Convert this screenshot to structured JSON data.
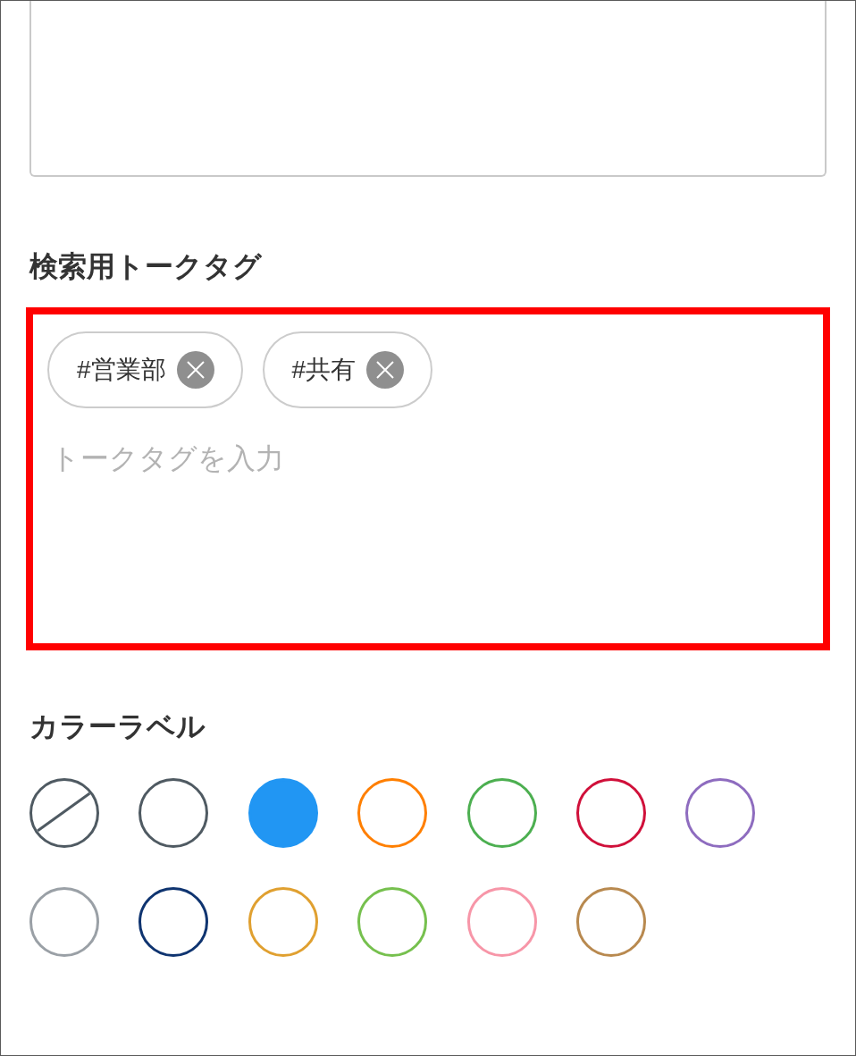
{
  "tag_section": {
    "heading": "検索用トークタグ",
    "field": {
      "highlighted": true,
      "tags": [
        "#営業部",
        "#共有"
      ],
      "placeholder": "トークタグを入力"
    }
  },
  "color_section": {
    "heading": "カラーラベル",
    "swatches": [
      {
        "kind": "none",
        "color": "#4f5a62",
        "selected": false
      },
      {
        "kind": "color",
        "color": "#4f5a62",
        "selected": false
      },
      {
        "kind": "color",
        "color": "#2196f3",
        "selected": true
      },
      {
        "kind": "color",
        "color": "#ff7f00",
        "selected": false
      },
      {
        "kind": "color",
        "color": "#4caf50",
        "selected": false
      },
      {
        "kind": "color",
        "color": "#d0103a",
        "selected": false
      },
      {
        "kind": "color",
        "color": "#8e6cbf",
        "selected": false
      },
      {
        "kind": "color",
        "color": "#9aa0a6",
        "selected": false
      },
      {
        "kind": "color",
        "color": "#0f3470",
        "selected": false
      },
      {
        "kind": "color",
        "color": "#e0a030",
        "selected": false
      },
      {
        "kind": "color",
        "color": "#76c04e",
        "selected": false
      },
      {
        "kind": "color",
        "color": "#f796a8",
        "selected": false
      },
      {
        "kind": "color",
        "color": "#b8894f",
        "selected": false
      }
    ]
  }
}
